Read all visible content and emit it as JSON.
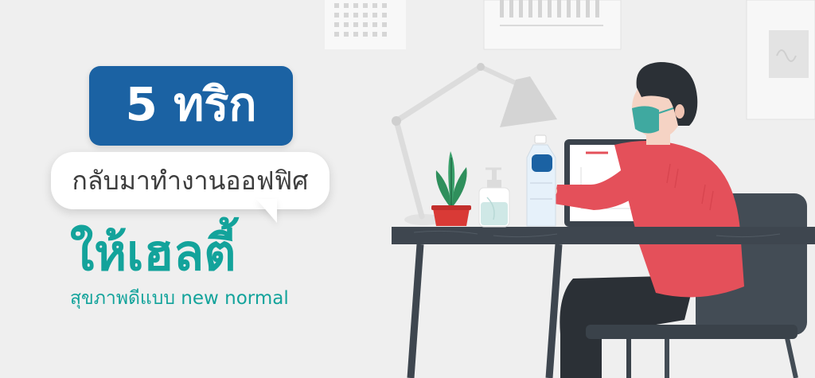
{
  "banner": {
    "headline": "5 ทริก",
    "subheadline": "กลับมาทำงานออฟฟิศ",
    "highlight": "ให้เฮลตี้",
    "tagline": "สุขภาพดีแบบ new normal"
  },
  "colors": {
    "background": "#efefef",
    "headline_bubble": "#1b62a3",
    "accent_teal": "#13a39b",
    "sweater": "#e4505a",
    "chair": "#434c55",
    "desk": "#3e464f",
    "hair": "#2b3036",
    "mask": "#3fa9a0",
    "plant": "#2f8f5c",
    "pot": "#d93a36"
  },
  "illustration": {
    "icons": [
      "desk-lamp-icon",
      "potted-plant-icon",
      "hand-sanitizer-icon",
      "water-bottle-icon",
      "laptop-icon",
      "office-chair-icon",
      "masked-worker-icon"
    ]
  }
}
